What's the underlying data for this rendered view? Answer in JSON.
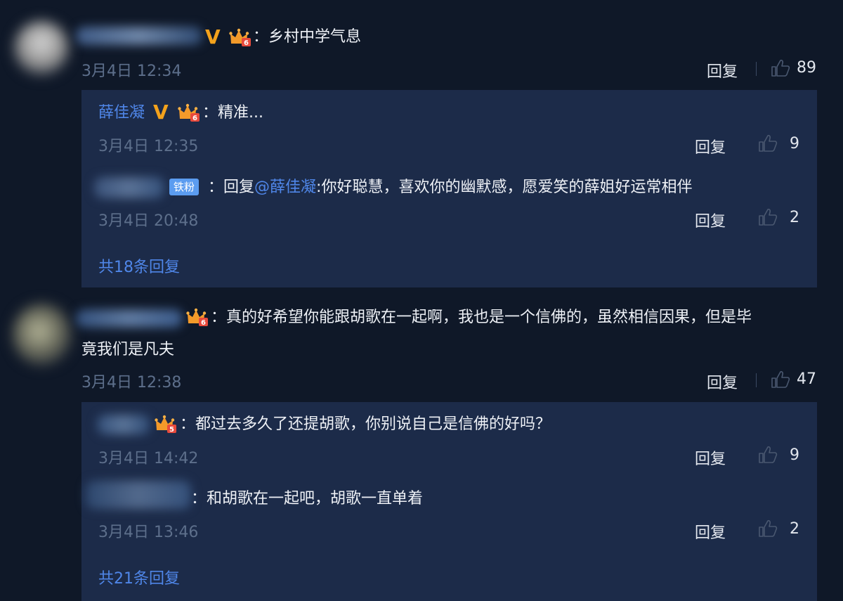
{
  "comments": [
    {
      "text": "：乡村中学气息",
      "time": "3月4日 12:34",
      "reply_label": "回复",
      "likes": "89",
      "replies": [
        {
          "user": "薛佳凝",
          "text": "：精准...",
          "time": "3月4日 12:35",
          "reply_label": "回复",
          "likes": "9"
        },
        {
          "badge": "铁粉",
          "prefix": "：回复",
          "mention": "@薛佳凝",
          "text": ":你好聪慧，喜欢你的幽默感，愿爱笑的薛姐好运常相伴",
          "time": "3月4日 20:48",
          "reply_label": "回复",
          "likes": "2"
        }
      ],
      "more_replies": "共18条回复"
    },
    {
      "text_line1": "：真的好希望你能跟胡歌在一起啊，我也是一个信佛的，虽然相信因果，但是毕",
      "text_line2": "竟我们是凡夫",
      "time": "3月4日 12:38",
      "reply_label": "回复",
      "likes": "47",
      "replies": [
        {
          "text": "：都过去多久了还提胡歌，你别说自己是信佛的好吗？",
          "time": "3月4日 14:42",
          "reply_label": "回复",
          "likes": "9"
        },
        {
          "text": "：和胡歌在一起吧，胡歌一直单着",
          "time": "3月4日 13:46",
          "reply_label": "回复",
          "likes": "2"
        }
      ],
      "more_replies": "共21条回复"
    }
  ],
  "colors": {
    "background": "#0f1828",
    "panel": "#1c2b49",
    "link": "#4f86e8",
    "timestamp": "#5d6f8b",
    "verified": "#f3a21c",
    "crown": "#f39a2a",
    "fan_badge": "#5b9cf0"
  },
  "icons": [
    "verified-v-icon",
    "crown-level-icon",
    "thumbs-up-icon"
  ]
}
